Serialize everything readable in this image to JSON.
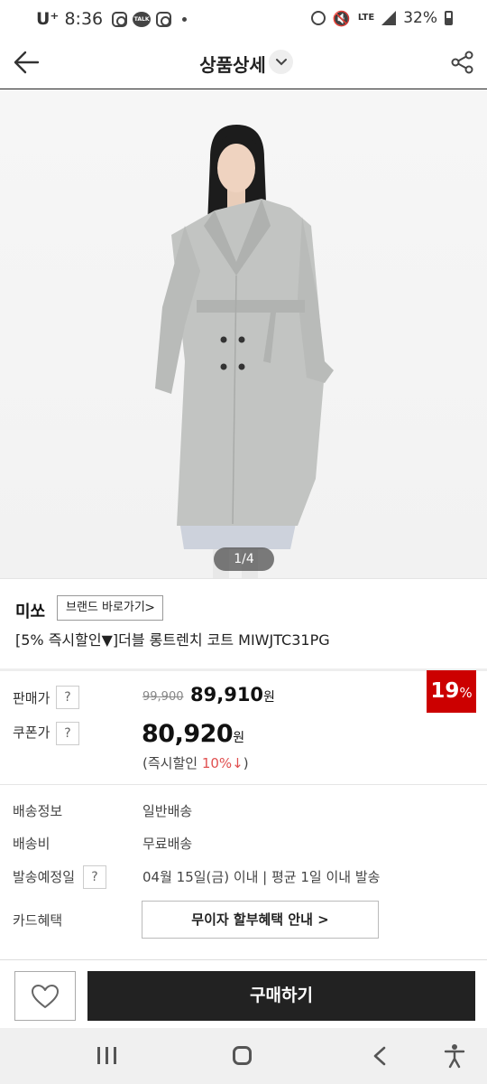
{
  "status_bar": {
    "carrier": "U⁺",
    "time": "8:36",
    "talk_label": "TALK",
    "network": "LTE",
    "battery": "32%"
  },
  "header": {
    "title": "상품상세"
  },
  "gallery": {
    "counter": "1/4"
  },
  "product": {
    "brand": "미쏘",
    "brand_link": "브랜드 바로가기",
    "name": "[5% 즉시할인▼]더블 롱트렌치 코트 MIWJTC31PG"
  },
  "price": {
    "sale_label": "판매가",
    "original": "99,900",
    "sale": "89,910",
    "unit": "원",
    "discount_rate": "19",
    "discount_unit": "%",
    "coupon_label": "쿠폰가",
    "coupon": "80,920",
    "instant_prefix": "(즉시할인 ",
    "instant_rate": "10%↓",
    "instant_suffix": ")",
    "help": "?"
  },
  "delivery": {
    "info_label": "배송정보",
    "info_value": "일반배송",
    "fee_label": "배송비",
    "fee_value": "무료배송",
    "date_label": "발송예정일",
    "date_value": "04월 15일(금) 이내 | 평균 1일 이내 발송",
    "card_label": "카드혜택",
    "card_button": "무이자 할부혜택 안내"
  },
  "buy_bar": {
    "buy_label": "구매하기"
  }
}
